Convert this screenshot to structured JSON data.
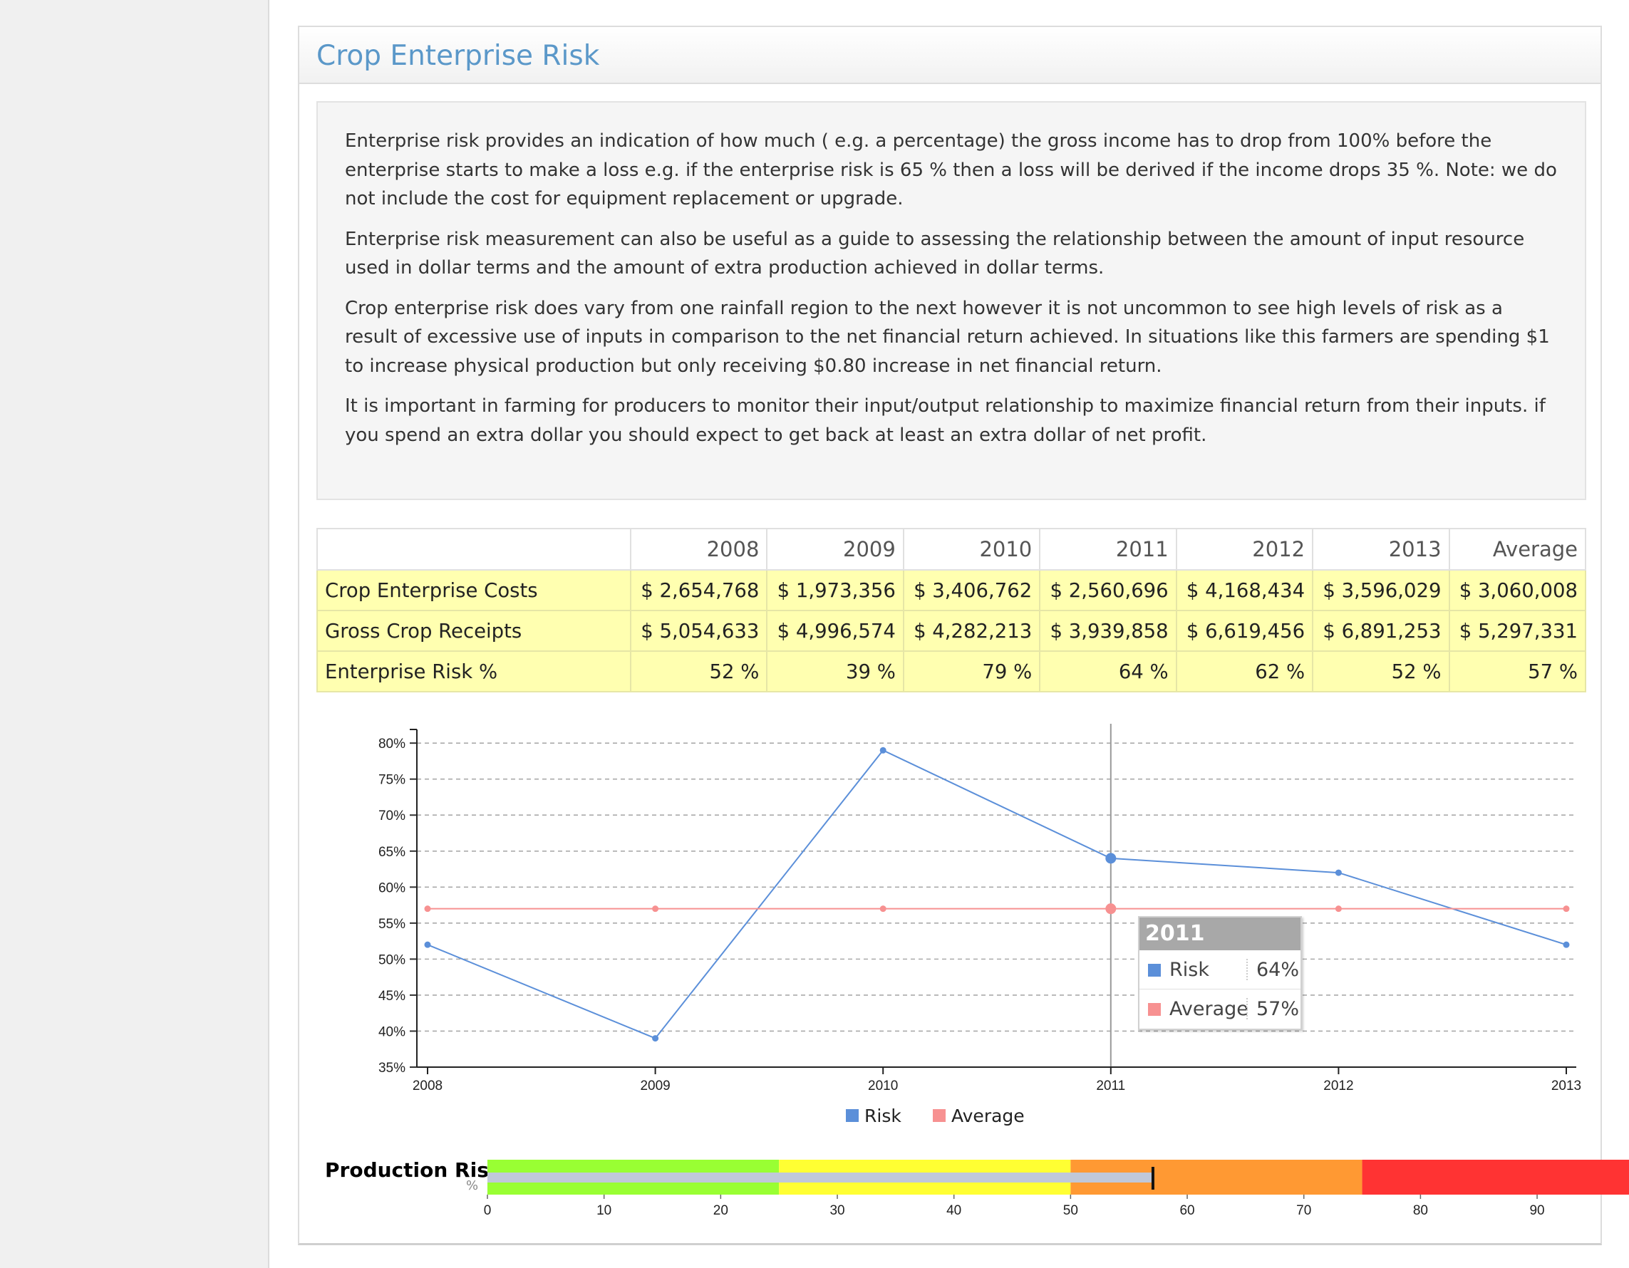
{
  "panel": {
    "title": "Crop Enterprise Risk"
  },
  "info": {
    "paragraphs": [
      "Enterprise risk provides an indication of how much ( e.g. a percentage) the gross income has to drop from 100% before the enterprise starts to make a loss e.g. if the enterprise risk is 65 % then a loss will be derived if the income drops 35 %. Note: we do not include the cost for equipment replacement or upgrade.",
      "Enterprise risk measurement can also be useful as a guide to assessing the relationship between the amount of input resource used in dollar terms and the amount of extra production achieved in dollar terms.",
      "Crop enterprise risk does vary from one rainfall region to the next however it is not uncommon to see high levels of risk as a result of excessive use of inputs in comparison to the net financial return achieved. In situations like this farmers are spending $1 to increase physical production but only receiving $0.80 increase in net financial return.",
      "It is important in farming for producers to monitor their input/output relationship to maximize financial return from their inputs. if you spend an extra dollar you should expect to get back at least an extra dollar of net profit."
    ]
  },
  "table": {
    "headers": [
      "",
      "2008",
      "2009",
      "2010",
      "2011",
      "2012",
      "2013",
      "Average"
    ],
    "rows": [
      {
        "label": "Crop Enterprise Costs",
        "cells": [
          "$ 2,654,768",
          "$ 1,973,356",
          "$ 3,406,762",
          "$ 2,560,696",
          "$ 4,168,434",
          "$ 3,596,029",
          "$ 3,060,008"
        ]
      },
      {
        "label": "Gross Crop Receipts",
        "cells": [
          "$ 5,054,633",
          "$ 4,996,574",
          "$ 4,282,213",
          "$ 3,939,858",
          "$ 6,619,456",
          "$ 6,891,253",
          "$ 5,297,331"
        ]
      },
      {
        "label": "Enterprise Risk %",
        "cells": [
          "52 %",
          "39 %",
          "79 %",
          "64 %",
          "62 %",
          "52 %",
          "57 %"
        ]
      }
    ]
  },
  "chart_data": {
    "type": "line",
    "x": [
      "2008",
      "2009",
      "2010",
      "2011",
      "2012",
      "2013"
    ],
    "series": [
      {
        "name": "Risk",
        "values": [
          52,
          39,
          79,
          64,
          62,
          52
        ],
        "color": "#5b8fd9"
      },
      {
        "name": "Average",
        "values": [
          57,
          57,
          57,
          57,
          57,
          57
        ],
        "color": "#f79191"
      }
    ],
    "yticks": [
      "35%",
      "40%",
      "45%",
      "50%",
      "55%",
      "60%",
      "65%",
      "70%",
      "75%",
      "80%"
    ],
    "ylim": [
      35,
      81.5
    ],
    "grid": true,
    "legend": "bottom-center",
    "highlight_index": 3
  },
  "tooltip": {
    "title": "2011",
    "rows": [
      {
        "name": "Risk",
        "value": "64%",
        "color": "#5b8fd9"
      },
      {
        "name": "Average",
        "value": "57%",
        "color": "#f79191"
      }
    ]
  },
  "legend": {
    "risk": "Risk",
    "average": "Average",
    "risk_color": "#5b8fd9",
    "average_color": "#f79191"
  },
  "production_risk": {
    "title": "Production Risk",
    "unit": "%",
    "value": 57,
    "max": 98,
    "ticks": [
      "0",
      "10",
      "20",
      "30",
      "40",
      "50",
      "60",
      "70",
      "80",
      "90"
    ],
    "bands": [
      {
        "from": 0,
        "to": 25,
        "color": "#99ff33"
      },
      {
        "from": 25,
        "to": 50,
        "color": "#ffff33"
      },
      {
        "from": 50,
        "to": 75,
        "color": "#ff9933"
      },
      {
        "from": 75,
        "to": 98,
        "color": "#ff3333"
      }
    ],
    "bar_color": "#c0c8d8"
  }
}
